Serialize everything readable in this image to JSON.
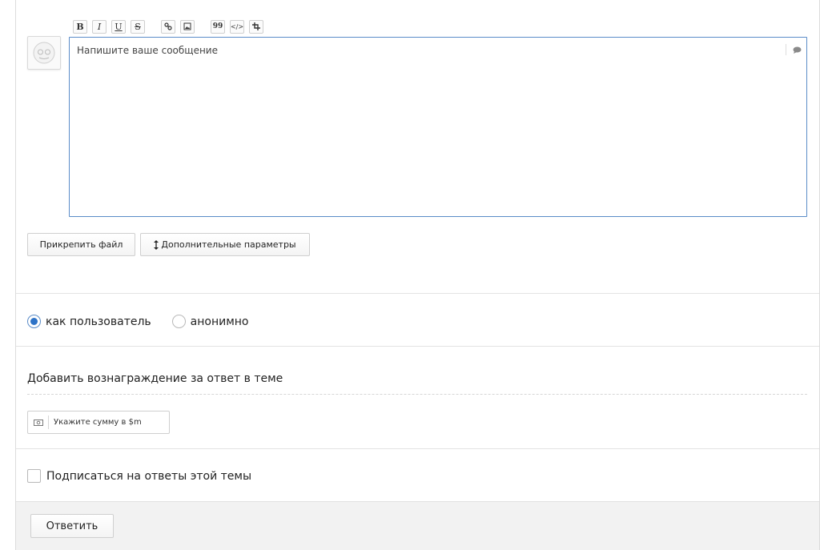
{
  "editor": {
    "toolbar": {
      "bold": "B",
      "italic": "I",
      "underline": "U",
      "strike": "S",
      "link_icon": "link-icon",
      "image_icon": "image-icon",
      "quote": "99",
      "code": "</>",
      "crop_icon": "crop-icon"
    },
    "placeholder": "Напишите ваше сообщение",
    "bubble_icon": "speech-bubble-icon"
  },
  "actions": {
    "attach_label": "Прикрепить файл",
    "extra_label": "Дополнительные параметры"
  },
  "identity": {
    "options": [
      {
        "label": "как пользователь",
        "selected": true
      },
      {
        "label": "анонимно",
        "selected": false
      }
    ]
  },
  "reward": {
    "title": "Добавить вознаграждение за ответ в теме",
    "placeholder": "Укажите сумму в $m"
  },
  "subscribe": {
    "label": "Подписаться на ответы этой темы",
    "checked": false
  },
  "footer": {
    "reply_label": "Ответить"
  },
  "colors": {
    "accent": "#2e73c7",
    "border": "#cfcfcf"
  }
}
